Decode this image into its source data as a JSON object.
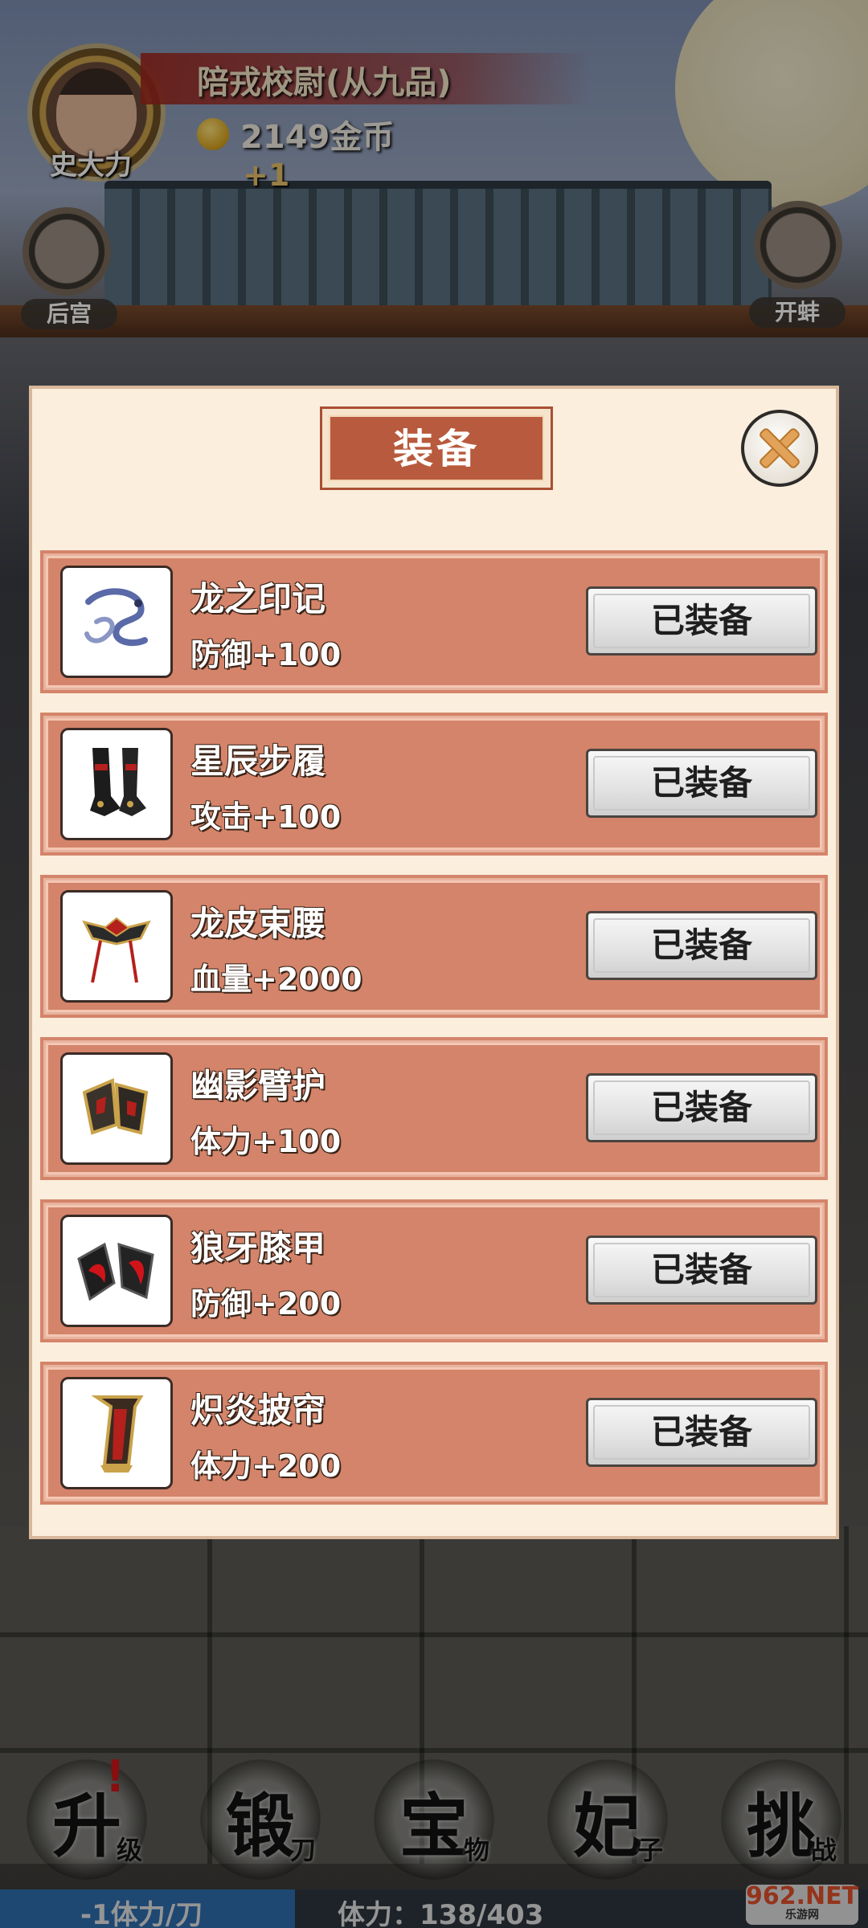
{
  "player": {
    "name": "史大力",
    "rank": "陪戎校尉(从九品)",
    "gold": "2149金币",
    "gain": "+1"
  },
  "side_buttons": {
    "left_label": "后宫",
    "right_label": "开蚌"
  },
  "panel": {
    "title": "装备",
    "close_icon": "close-icon",
    "items": [
      {
        "name": "龙之印记",
        "stat": "防御+100",
        "button": "已装备",
        "icon": "dragon-mark-icon"
      },
      {
        "name": "星辰步履",
        "stat": "攻击+100",
        "button": "已装备",
        "icon": "boots-icon"
      },
      {
        "name": "龙皮束腰",
        "stat": "血量+2000",
        "button": "已装备",
        "icon": "belt-icon"
      },
      {
        "name": "幽影臂护",
        "stat": "体力+100",
        "button": "已装备",
        "icon": "bracer-icon"
      },
      {
        "name": "狼牙膝甲",
        "stat": "防御+200",
        "button": "已装备",
        "icon": "kneeguard-icon"
      },
      {
        "name": "炽炎披帘",
        "stat": "体力+200",
        "button": "已装备",
        "icon": "cape-icon"
      }
    ]
  },
  "bottom_nav": [
    {
      "glyph": "升",
      "sub": "级",
      "alert": "!"
    },
    {
      "glyph": "锻",
      "sub": "刀"
    },
    {
      "glyph": "宝",
      "sub": "物"
    },
    {
      "glyph": "妃",
      "sub": "子"
    },
    {
      "glyph": "挑",
      "sub": "战"
    }
  ],
  "stamina": {
    "cost": "-1体力/刀",
    "value": "体力：138/403",
    "fraction": 0.34
  },
  "watermark": {
    "brand": "962.NET",
    "sub": "乐游网"
  }
}
